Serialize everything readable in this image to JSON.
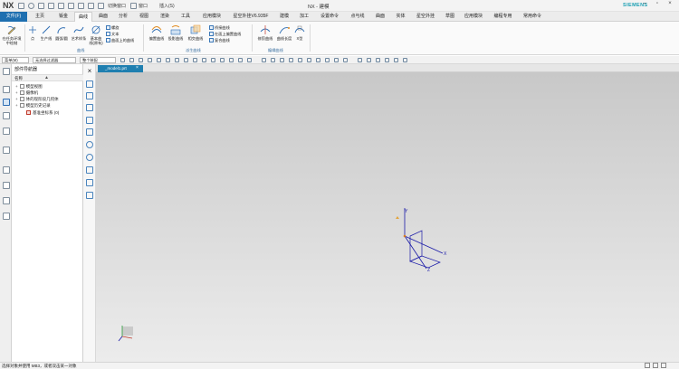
{
  "app": {
    "logo": "NX",
    "window_title": "NX - 建模",
    "brand": "SIEMENS",
    "qa_switch_window": "切换窗口",
    "qa_window": "窗口",
    "qa_insert": "插入(S)"
  },
  "tabs": [
    "文件(F)",
    "主页",
    "钣金",
    "曲线",
    "曲面",
    "分析",
    "视图",
    "渲染",
    "工具",
    "应用模块",
    "星空外挂V6.935F",
    "建模",
    "加工",
    "设置命令",
    "点与线",
    "曲面",
    "实体",
    "星空外挂",
    "草图",
    "应用模块",
    "编程专用",
    "常用命令"
  ],
  "active_tab": "曲线",
  "ribbon": {
    "buttons": [
      "在任务环境中绘制",
      "点",
      "生产线",
      "圆弧/圆",
      "艺术样条",
      "基本曲线(原有)",
      "偏置曲线",
      "投影曲线",
      "相交曲线",
      "修剪曲线",
      "曲线长度",
      "X型"
    ],
    "small_items": [
      "螺旋",
      "文本",
      "曲面上的曲线",
      "桥接曲线",
      "在面上偏置曲线",
      "复合曲线"
    ],
    "groups": [
      "曲线",
      "派生曲线",
      "编辑曲线"
    ]
  },
  "toolbar2": {
    "menu": "菜单(M)",
    "filter": "无选择过滤器",
    "scope": "整个装配"
  },
  "navigator": {
    "title": "部件导航器",
    "column_name": "名称",
    "items": [
      {
        "label": "模型视图",
        "depth": 0
      },
      {
        "label": "摄像机",
        "depth": 0
      },
      {
        "label": "体的现阶段几何体",
        "depth": 0
      },
      {
        "label": "模型历史记录",
        "depth": 0
      },
      {
        "label": "基准坐标系 (0)",
        "depth": 1
      }
    ]
  },
  "document_tab": "_model1.prt",
  "status": "选择对象并使用 MB3，或者双击某一对象",
  "colors": {
    "accent": "#1e6fb0",
    "doc_tab": "#1f7fb0",
    "triad_blue": "#1a1aa8",
    "siemens": "#1a9fb3"
  }
}
